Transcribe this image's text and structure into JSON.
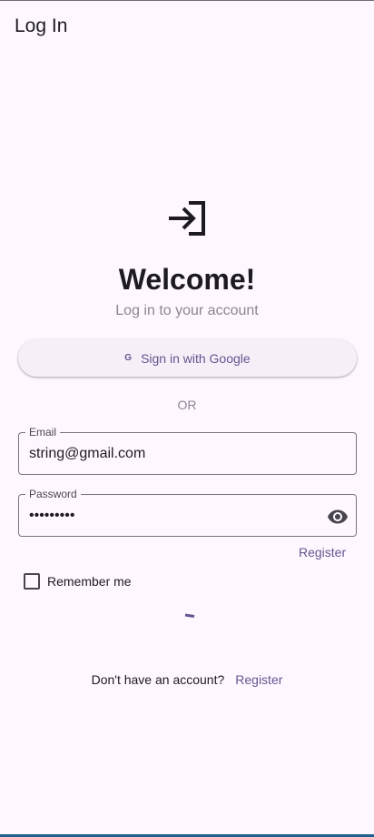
{
  "app_bar": {
    "title": "Log In"
  },
  "header": {
    "icon": "login-icon",
    "title": "Welcome!",
    "subtitle": "Log in to your account"
  },
  "google_button": {
    "icon_glyph": "G",
    "label": "Sign in with Google"
  },
  "divider": {
    "text": "OR"
  },
  "email_field": {
    "label": "Email",
    "value": "string@gmail.com"
  },
  "password_field": {
    "label": "Password",
    "value": "•••••••••",
    "toggle_icon": "eye-icon"
  },
  "links": {
    "register_top": "Register"
  },
  "remember": {
    "label": "Remember me",
    "checked": false
  },
  "footer": {
    "prompt": "Don't have an account?",
    "register": "Register"
  },
  "colors": {
    "background": "#fef7ff",
    "primary": "#65558f",
    "text": "#1d1b20",
    "muted": "#8a8691"
  }
}
